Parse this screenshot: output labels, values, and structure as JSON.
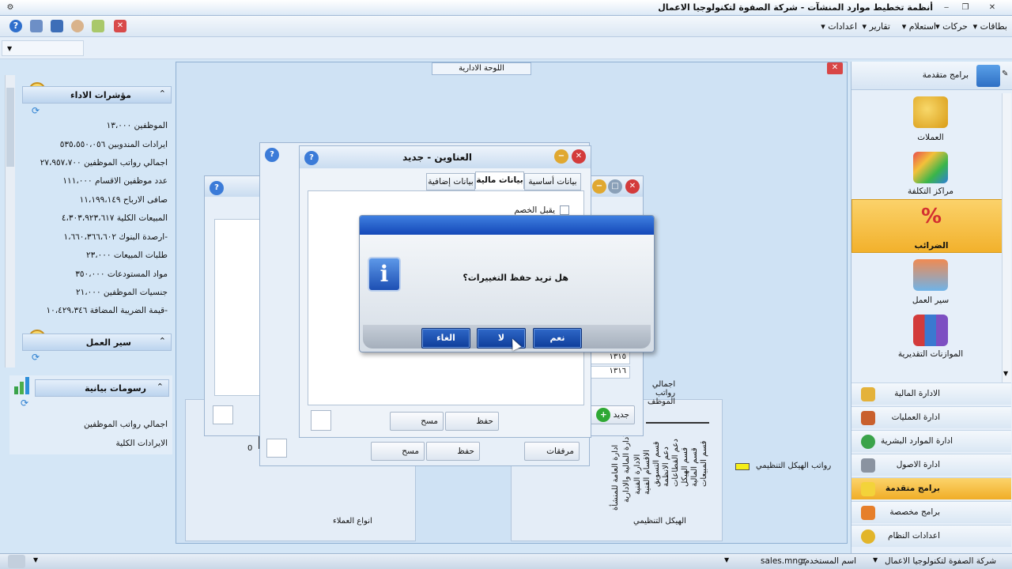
{
  "window": {
    "title": "أنظمة تخطيط موارد المنشآت - شركة الصفوة لتكنولوجيا الاعمال",
    "controls": {
      "close": "✕",
      "restore": "❐",
      "minimize": "‒"
    }
  },
  "menu": {
    "items": [
      "بطاقات",
      "حركات",
      "استعلام",
      "تقارير",
      "اعدادات"
    ]
  },
  "mdi": {
    "tab_label": "اللوحة الادارية",
    "close": "✕"
  },
  "left_panel": {
    "kpi_header": "مؤشرات الاداء",
    "kpis": [
      "الموظفين ١٣،٠٠٠",
      "ايرادات المندوبين ٥٣٥،٥٥٠،٠٥٦",
      "اجمالي رواتب الموظفين ٢٧،٩٥٧،٧٠٠",
      "عدد موظفين الاقسام ١١١،٠٠٠",
      "صافى الارباح ١١،١٩٩،١٤٩",
      "المبيعات الكلية ٤،٣٠٣،٩٢٣،٦١٧",
      "-ارصدة البنوك ١،٦٦٠،٣٦٦،٦٠٢",
      "طلبات المبيعات ٢٣،٠٠٠",
      "مواد المستودعات ٣٥٠،٠٠٠",
      "جنسيات الموظفين ٢١،٠٠٠",
      "-قيمة الضريبة المضافة ١٠،٤٢٩،٣٤٦"
    ],
    "workflow_header": "سير العمل",
    "charts_header": "رسومات بيانية",
    "chart_links": [
      "اجمالي رواتب الموظفين",
      "الايرادات الكلية"
    ]
  },
  "right_panel": {
    "header": "برامج متقدمة",
    "items": [
      {
        "label": "العملات",
        "icon": "coins-icon"
      },
      {
        "label": "مراكز التكلفة",
        "icon": "puzzle-icon"
      },
      {
        "label": "الضرائب",
        "icon": "tax-percent-icon",
        "selected": true
      },
      {
        "label": "سير العمل",
        "icon": "workflow-icon"
      },
      {
        "label": "الموازنات التقديرية",
        "icon": "books-icon"
      }
    ],
    "nav": [
      {
        "label": "الادارة المالية",
        "icon": "coins-icon"
      },
      {
        "label": "ادارة العمليات",
        "icon": "truck-icon"
      },
      {
        "label": "ادارة الموارد البشرية",
        "icon": "person-icon"
      },
      {
        "label": "ادارة الاصول",
        "icon": "building-icon"
      },
      {
        "label": "برامج متقدمة",
        "icon": "star-icon",
        "active": true
      },
      {
        "label": "برامج مخصصة",
        "icon": "puzzle-icon"
      },
      {
        "label": "اعدادات النظام",
        "icon": "gear-icon"
      }
    ]
  },
  "address_window": {
    "title": "العناوين - جديد",
    "tabs": [
      "بيانات أساسية",
      "بيانات مالية",
      "بيانات إضافية"
    ],
    "checkbox_label": "يقبل الخصم",
    "save": "حفظ",
    "delete": "مسح"
  },
  "back_window": {
    "save": "حفظ",
    "delete": "مسح",
    "attachments": "مرفقات",
    "new": "جديد",
    "rows": [
      "١٣١٥",
      "١٣١٦"
    ],
    "total_label": "اجمالي رواتب الموظف"
  },
  "charts": {
    "org_title": "الهيكل التنظيمي",
    "org_legend": "رواتب الهيكل التنظيمي",
    "customers_title": "انواع العملاء",
    "zero": "0",
    "org_labels": [
      "قسم المبيعات",
      "قسم المالية",
      "قسم الهيكل",
      "دعم القطاعات",
      "دعم الانظمة",
      "قسم التسويق",
      "الاقسام الفنية",
      "الادارة الفنية",
      "الادارة المالية والادارية",
      "ادارة العامة للمنشأة"
    ]
  },
  "dialog": {
    "message": "هل تريد حفظ التغييرات؟",
    "yes": "نعم",
    "no": "لا",
    "cancel": "الغاء"
  },
  "status": {
    "company": "شركة الصفوة لتكنولوجيا الاعمال",
    "user_label": "اسم المستخدم:",
    "user": "sales.mngr"
  },
  "colors": {
    "accent": "#1448b8",
    "selected": "#f2b12c",
    "legend_yellow": "#f5ee18"
  }
}
